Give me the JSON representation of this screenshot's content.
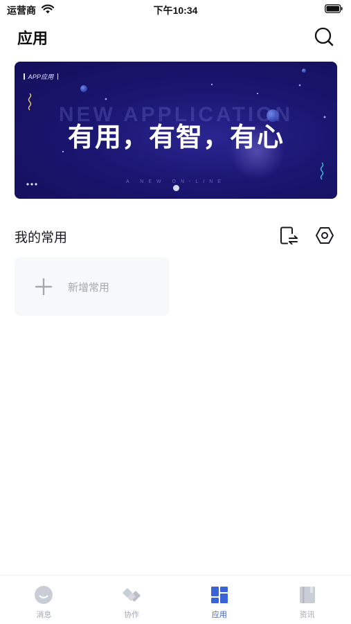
{
  "status_bar": {
    "carrier": "运营商",
    "time": "下午10:34"
  },
  "header": {
    "title": "应用",
    "search_icon": "search-icon"
  },
  "banner": {
    "tag": "APP应用",
    "background_text": "NEW APPLICATION",
    "headline": "有用，有智，有心",
    "subline": "A NEW ON-LINE",
    "colors": {
      "background": "#1a1670",
      "accent_yellow": "#e9d46a",
      "accent_cyan": "#3fc6d8"
    }
  },
  "favorites": {
    "title": "我的常用",
    "switch_icon": "switch-layout-icon",
    "settings_icon": "hexagon-settings-icon",
    "add_label": "新增常用"
  },
  "tab_bar": {
    "active_color": "#3a63d8",
    "inactive_color": "#a3a8b3",
    "tabs": [
      {
        "label": "消息",
        "icon": "message-icon",
        "active": false
      },
      {
        "label": "协作",
        "icon": "collaboration-icon",
        "active": false
      },
      {
        "label": "应用",
        "icon": "apps-grid-icon",
        "active": true
      },
      {
        "label": "资讯",
        "icon": "news-book-icon",
        "active": false
      }
    ]
  }
}
